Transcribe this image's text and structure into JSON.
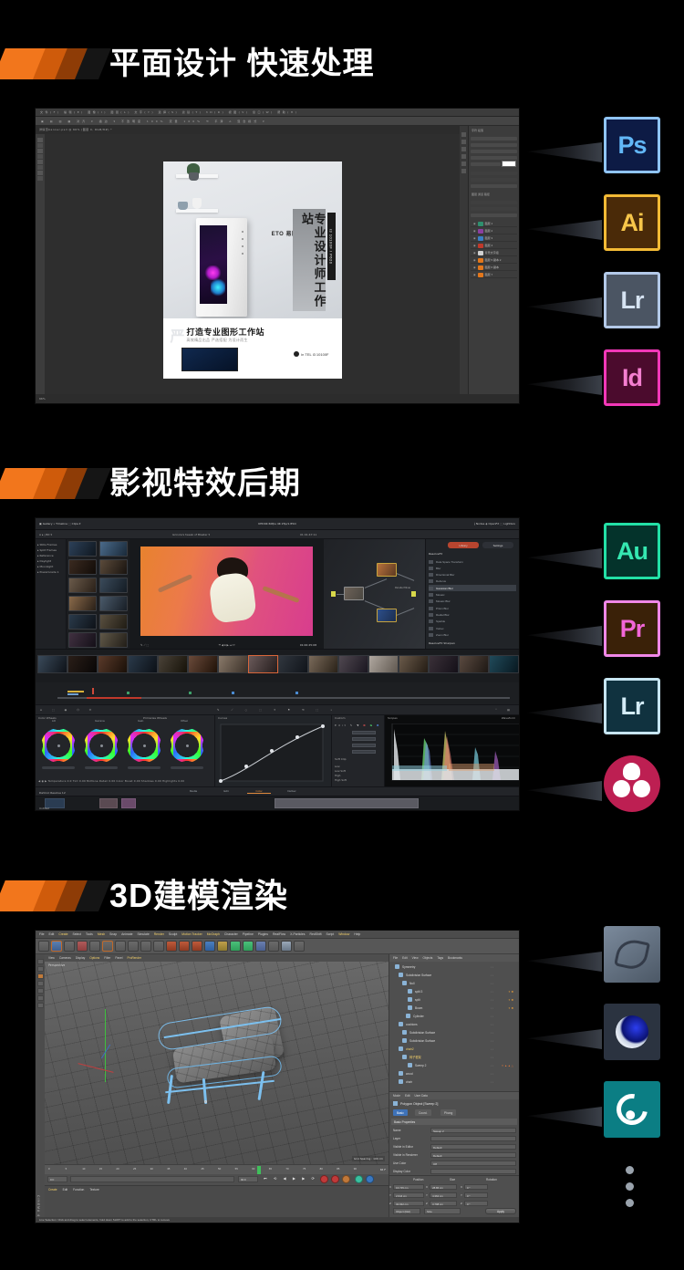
{
  "page": {
    "background": "#000000",
    "accent": "#f2761c"
  },
  "sections": [
    {
      "id": "graphic-design",
      "title": "平面设计 快速处理",
      "apps": [
        {
          "key": "ps",
          "label": "Ps",
          "name": "photoshop",
          "color": "#62b7f7"
        },
        {
          "key": "ai",
          "label": "Ai",
          "name": "illustrator",
          "color": "#f7c64a"
        },
        {
          "key": "lr",
          "label": "Lr",
          "name": "lightroom",
          "color": "#d6e3f2"
        },
        {
          "key": "id",
          "label": "Id",
          "name": "indesign",
          "color": "#f47fd0"
        }
      ]
    },
    {
      "id": "film-vfx",
      "title": "影视特效后期",
      "apps": [
        {
          "key": "au",
          "label": "Au",
          "name": "audition",
          "color": "#35e8b1"
        },
        {
          "key": "pr",
          "label": "Pr",
          "name": "premiere-pro",
          "color": "#f266d8"
        },
        {
          "key": "lr2",
          "label": "Lr",
          "name": "lightroom",
          "color": "#d4ecf7"
        },
        {
          "key": "resolve",
          "label": "",
          "name": "davinci-resolve",
          "color": "#bd1f52"
        }
      ]
    },
    {
      "id": "3d-modeling",
      "title": "3D建模渲染",
      "apps": [
        {
          "key": "max",
          "label": "",
          "name": "3ds-max",
          "color": "#4c5866"
        },
        {
          "key": "c4d",
          "label": "",
          "name": "cinema-4d",
          "color": "#2c3ef0"
        },
        {
          "key": "maya",
          "label": "",
          "name": "maya",
          "color": "#0b7e84"
        },
        {
          "key": "more",
          "label": "",
          "name": "more-apps",
          "color": "#9aa3ad"
        }
      ]
    }
  ],
  "photoshop": {
    "menus": [
      "文件(F)",
      "编辑(E)",
      "图像(I)",
      "图层(L)",
      "文字(Y)",
      "选择(S)",
      "滤镜(T)",
      "3D(D)",
      "视图(V)",
      "窗口(W)",
      "帮助(H)"
    ],
    "tabs": [
      "详情页banner.psd @ 66% (图层 0, RGB/8#) *",
      "主图.psd @ 50% (RGB/8) *",
      "cpu主图banner.jpg @ 100% (RGB/8#) *"
    ],
    "zoom": "66%",
    "document": {
      "brand": "ETO 易图",
      "spec_tag": "i3 10100F / P620",
      "vertical_headline": "专业设计师工作站",
      "headline": "打造专业图形工作站",
      "subtitle": "高效精品出品  严选搭配  为设计而生",
      "cpu_note": "in TEL i3 10100F"
    },
    "character_panel": "字符  段落",
    "layers_panel": "图层  通道  路径",
    "layers": [
      {
        "name": "图层 1",
        "thumb": "#2f8f6e"
      },
      {
        "name": "图层 2",
        "thumb": "#8b3fa0"
      },
      {
        "name": "图层 3",
        "thumb": "#3a7fc4"
      },
      {
        "name": "图层 4",
        "thumb": "#c0392b"
      },
      {
        "name": "背景文字组",
        "thumb": "#d0d0d0"
      },
      {
        "name": "图层 5 副本 2",
        "thumb": "#e2771c"
      },
      {
        "name": "图层 6 副本",
        "thumb": "#e2771c"
      },
      {
        "name": "图层 7",
        "thumb": "#e2771c"
      }
    ]
  },
  "resolve": {
    "project_title": "UHD4K 60fps 4K 25p/1.85m",
    "pages": [
      "Media",
      "Edit",
      "Color",
      "Deliver"
    ],
    "active_page": "Color",
    "header_buttons": [
      "Gallery",
      "Timeline",
      "Clips"
    ],
    "right_header": [
      "Nodes",
      "OpenFX",
      "Lightbox"
    ],
    "timecode": "01:00:25:08",
    "clip_timecode": "01:01:47:11",
    "gallery_groups": [
      "Stills Frames",
      "Split Frames",
      "Reference",
      "Daylight",
      "Moonlight",
      "PowerGrade 1"
    ],
    "openfx_header": "ResolveFX",
    "openfx_sections": [
      "ResolveFX Blur",
      "ResolveFX Sharpen"
    ],
    "openfx_items": [
      "Data Space Transform",
      "Blur",
      "Directional Blur",
      "Defocus",
      "Gaussian Blur",
      "Mosaic",
      "Mosaic Blur",
      "Prism Blur",
      "Radial Blur",
      "Sparkle",
      "Vortex",
      "Zoom Blur"
    ],
    "openfx_selected": "Gaussian Blur",
    "openfx_section2_items": [
      "Motion Noise 24"
    ],
    "wheels_panel": "Color Wheels",
    "wheels_mode": "Primaries Wheels",
    "wheels": [
      "Lift",
      "Gamma",
      "Gain",
      "Offset"
    ],
    "curves_panel": "Curves",
    "custom_panel": "Custom",
    "scopes_panel": "Scopes",
    "scope_type": "Waveform",
    "wheel_params": [
      "Temperature  0.0",
      "Tint  0.00",
      "Midtone Detail  0.00",
      "Color Boost  0.00",
      "Shadows  0.00",
      "Highlights  0.00"
    ],
    "curve_channels": [
      "Y",
      "R",
      "G",
      "B"
    ],
    "soft_clip_label": "Soft Clip",
    "soft_clip_rows": [
      "Low",
      "Low Soft",
      "High",
      "High Soft"
    ],
    "status": "DaVinci Resolve 12",
    "timeline_label": "Untitled"
  },
  "cinema4d": {
    "menus": [
      "File",
      "Edit",
      "Create",
      "Select",
      "Tools",
      "Mesh",
      "Snap",
      "Animate",
      "Simulate",
      "Render",
      "Sculpt",
      "Motion Tracker",
      "MoGraph",
      "Character",
      "Pipeline",
      "Plugins",
      "RealFlow",
      "X-Particles",
      "RedShift",
      "Script",
      "Window",
      "Help"
    ],
    "menu_highlight": [
      "Create",
      "Mesh",
      "Render",
      "Motion Tracker",
      "MoGraph",
      "Window"
    ],
    "viewport_menus": [
      "View",
      "Cameras",
      "Display",
      "Options",
      "Filter",
      "Panel",
      "ProRender"
    ],
    "viewport_label": "Perspective",
    "grid_spacing": "Grid Spacing : 100 cm",
    "object_manager_menus": [
      "File",
      "Edit",
      "View",
      "Objects",
      "Tags",
      "Bookmarks"
    ],
    "objects": [
      {
        "name": "Symmetry",
        "highlight": false
      },
      {
        "name": "Subdivision Surface",
        "highlight": false
      },
      {
        "name": "Null",
        "highlight": false
      },
      {
        "name": "split 3",
        "highlight": false
      },
      {
        "name": "split",
        "highlight": false
      },
      {
        "name": "Boom",
        "highlight": false
      },
      {
        "name": "Cylinder",
        "highlight": false
      },
      {
        "name": "cushions",
        "highlight": false
      },
      {
        "name": "Subdivision Surface",
        "highlight": false
      },
      {
        "name": "Subdivision Surface",
        "highlight": false
      },
      {
        "name": "chair2",
        "highlight": true
      },
      {
        "name": "椅子框架",
        "highlight": true
      },
      {
        "name": "Sweep 2",
        "highlight": false
      },
      {
        "name": "wood",
        "highlight": false
      },
      {
        "name": "chair",
        "highlight": false
      }
    ],
    "attribute_menus": [
      "Mode",
      "Edit",
      "User Data"
    ],
    "attribute_object": "Polygon Object [Sweep 2]",
    "attribute_tabs": [
      "Basic",
      "Coord.",
      "Phong"
    ],
    "attribute_active_tab": "Basic",
    "attribute_section": "Basic Properties",
    "attribute_rows": [
      {
        "label": "Name",
        "value": "Sweep 2"
      },
      {
        "label": "Layer",
        "value": ""
      },
      {
        "label": "Visible in Editor",
        "value": "Default"
      },
      {
        "label": "Visible in Renderer",
        "value": "Default"
      },
      {
        "label": "Use Color",
        "value": "Off"
      },
      {
        "label": "Display Color",
        "value": ""
      },
      {
        "label": "X-Ray",
        "value": ""
      }
    ],
    "material_menus": [
      "Create",
      "Edit",
      "Function",
      "Texture"
    ],
    "coord_headers": [
      "Position",
      "Size",
      "Rotation"
    ],
    "coord_rows": [
      {
        "axis": "X",
        "position": "16.745 cm",
        "size": "28.86 cm",
        "rotation": "0 °"
      },
      {
        "axis": "Y",
        "position": "2.644 cm",
        "size": "4.362 cm",
        "rotation": "0 °"
      },
      {
        "axis": "Z",
        "position": "32.932 cm",
        "size": "3.798 cm",
        "rotation": "0 °"
      }
    ],
    "coord_mode": "Object (Rel)",
    "coord_size_mode": "Size",
    "apply_label": "Apply",
    "timeline_ticks": [
      "0",
      "5",
      "10",
      "15",
      "20",
      "25",
      "30",
      "35",
      "40",
      "45",
      "50",
      "55",
      "60",
      "65",
      "70",
      "75",
      "80",
      "85",
      "90"
    ],
    "current_frame": "66 F",
    "frame_field": "0 F",
    "end_frame": "90 F",
    "brand": "CINEMA 4D",
    "status": "Live Selection: Click and drag to select elements, hold down SHIFT to add to the selection, CTRL to remove"
  }
}
